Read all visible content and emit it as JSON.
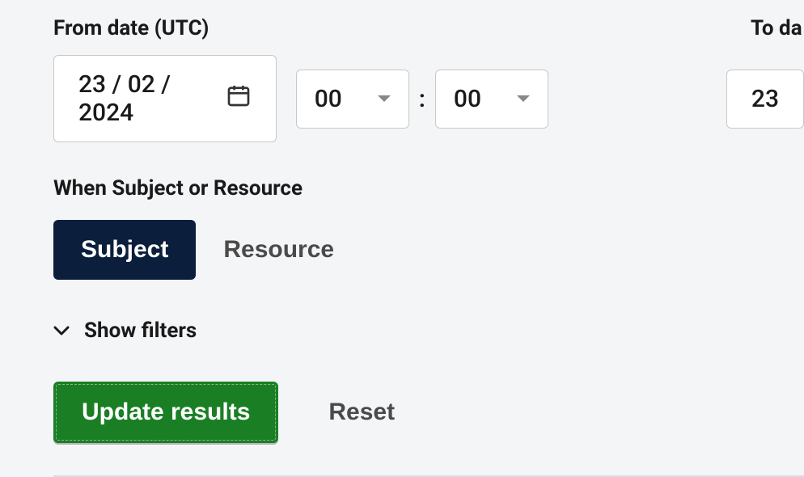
{
  "from": {
    "label": "From date (UTC)",
    "date": "23 / 02 / 2024",
    "hour": "00",
    "minute": "00"
  },
  "to": {
    "label_partial": "To da",
    "date_partial": "23"
  },
  "subject_resource": {
    "label": "When Subject or Resource",
    "subject": "Subject",
    "resource": "Resource"
  },
  "show_filters": "Show filters",
  "actions": {
    "update": "Update results",
    "reset": "Reset"
  }
}
